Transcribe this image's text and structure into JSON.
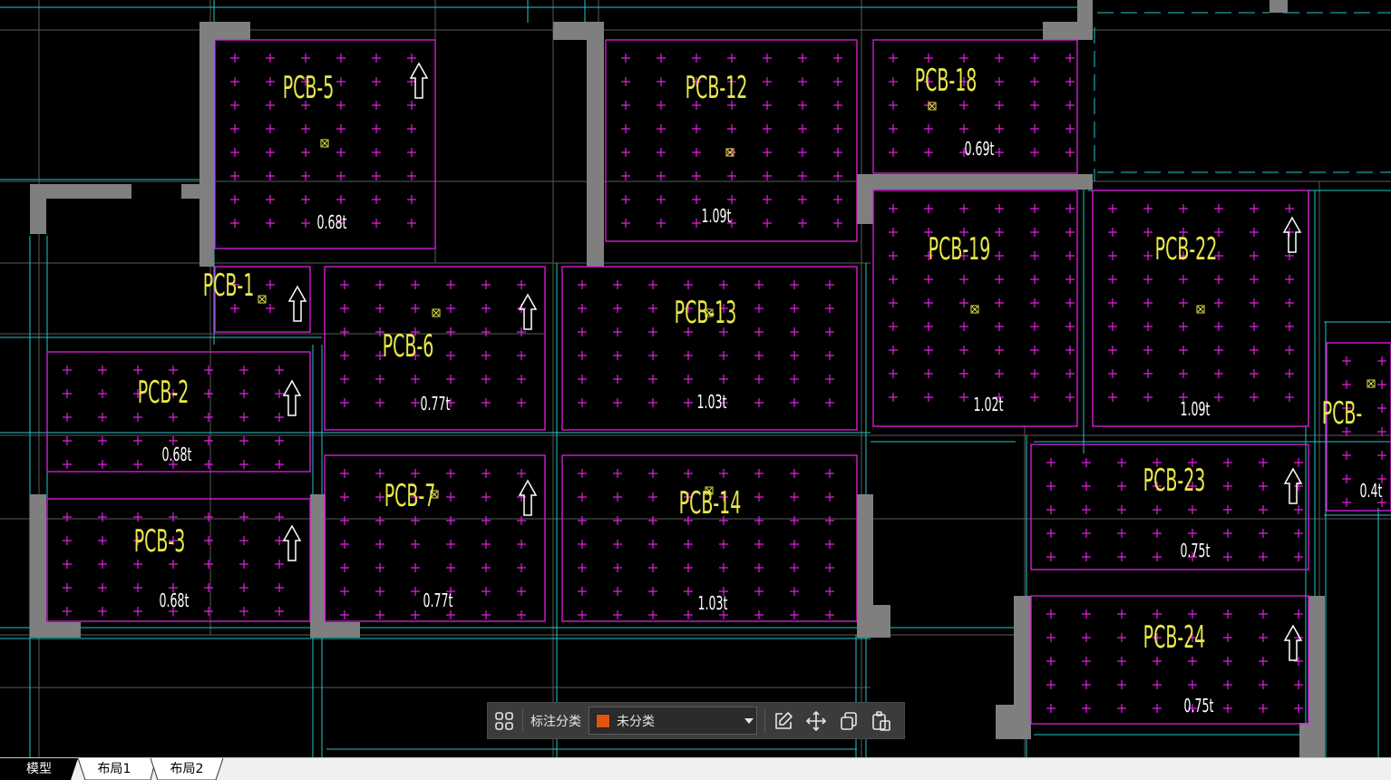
{
  "drawing": {
    "slabs": [
      {
        "id": "PCB-5",
        "label": "PCB-5",
        "weight": "0.68t"
      },
      {
        "id": "PCB-12",
        "label": "PCB-12",
        "weight": "1.09t"
      },
      {
        "id": "PCB-18",
        "label": "PCB-18",
        "weight": "0.69t"
      },
      {
        "id": "PCB-1",
        "label": "PCB-1",
        "weight": ""
      },
      {
        "id": "PCB-6",
        "label": "PCB-6",
        "weight": "0.77t"
      },
      {
        "id": "PCB-13",
        "label": "PCB-13",
        "weight": "1.03t"
      },
      {
        "id": "PCB-19",
        "label": "PCB-19",
        "weight": "1.02t"
      },
      {
        "id": "PCB-22",
        "label": "PCB-22",
        "weight": "1.09t"
      },
      {
        "id": "PCB-2",
        "label": "PCB-2",
        "weight": "0.68t"
      },
      {
        "id": "PCB-3",
        "label": "PCB-3",
        "weight": "0.68t"
      },
      {
        "id": "PCB-7",
        "label": "PCB-7",
        "weight": "0.77t"
      },
      {
        "id": "PCB-14",
        "label": "PCB-14",
        "weight": "1.03t"
      },
      {
        "id": "PCB-23",
        "label": "PCB-23",
        "weight": "0.75t"
      },
      {
        "id": "PCB-24",
        "label": "PCB-24",
        "weight": "0.75t"
      },
      {
        "id": "PCB-partial",
        "label": "PCB-",
        "weight": "0.4t"
      }
    ],
    "colors": {
      "background": "#000000",
      "slab_outline": "#e020e0",
      "grid_marks": "#e020e0",
      "labels": "#e8e84a",
      "weights": "#ffffff",
      "walls": "#7f7f7f",
      "axis_lines": "#20c8c8",
      "guide_lines": "#5a5a5a"
    }
  },
  "toolbar": {
    "layout_icon": "four-squares-icon",
    "label": "标注分类",
    "category_value": "未分类",
    "category_color": "#e0560e",
    "caret_icon": "caret-down-icon",
    "edit_icon": "edit-icon",
    "move_icon": "move-icon",
    "copy_icon": "copy-icon",
    "paste_icon": "paste-icon"
  },
  "tabs": [
    {
      "label": "模型",
      "active": true
    },
    {
      "label": "布局1",
      "active": false
    },
    {
      "label": "布局2",
      "active": false
    }
  ]
}
